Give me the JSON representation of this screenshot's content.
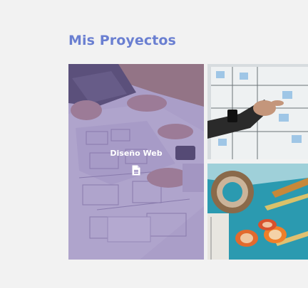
{
  "section": {
    "title": "Mis Proyectos"
  },
  "projects": [
    {
      "title": "Diseño Web",
      "icon": "document-icon",
      "hovered": true
    },
    {
      "title": "",
      "icon": "",
      "hovered": false
    },
    {
      "title": "",
      "icon": "",
      "hovered": false
    }
  ],
  "colors": {
    "accent": "#6a7fd1",
    "overlay": "#7662aa",
    "background": "#f2f2f2"
  }
}
